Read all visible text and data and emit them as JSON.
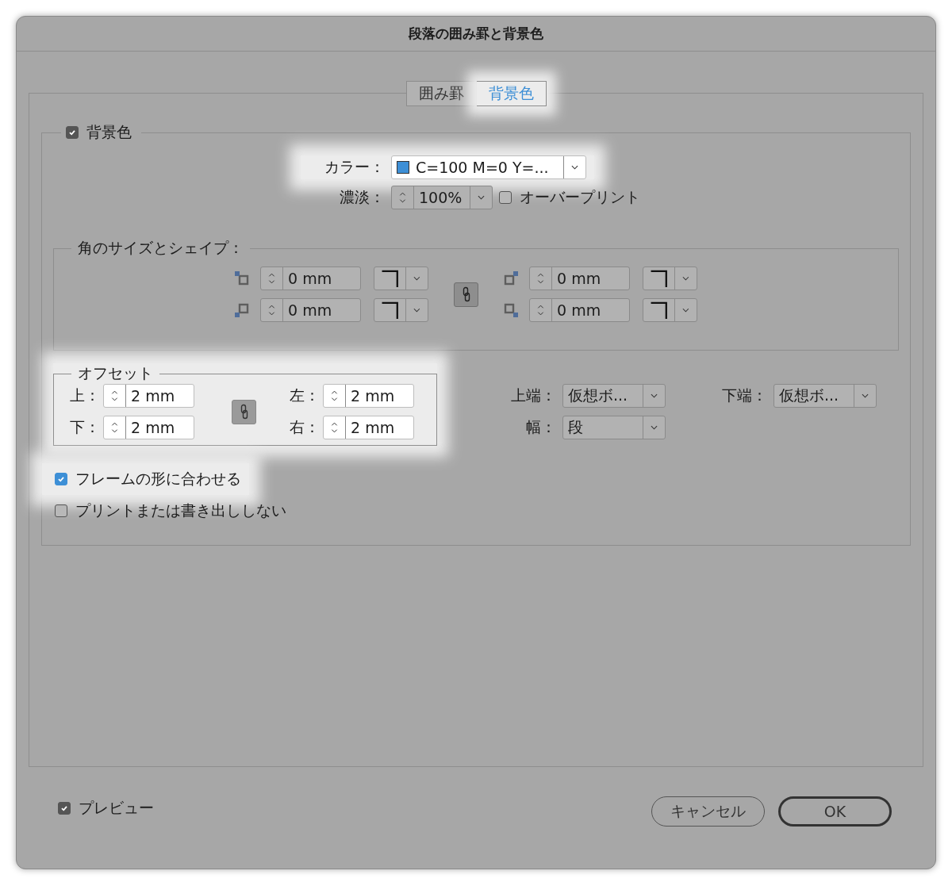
{
  "window": {
    "title": "段落の囲み罫と背景色"
  },
  "tabs": [
    {
      "label": "囲み罫",
      "selected": false,
      "highlighted": false
    },
    {
      "label": "背景色",
      "selected": true,
      "highlighted": true
    }
  ],
  "background": {
    "label": "背景色",
    "checked": true,
    "color": {
      "label": "カラー：",
      "value": "C=100 M=0 Y=...",
      "color": "#3d8fd6",
      "highlighted": true
    },
    "tint": {
      "label": "濃淡：",
      "value": "100%"
    },
    "overprint": {
      "label": "オーバープリント",
      "checked": false
    }
  },
  "corners": {
    "title": "角のサイズとシェイプ：",
    "items": [
      {
        "kind": "top-left",
        "value": "0 mm"
      },
      {
        "kind": "top-right",
        "value": "0 mm"
      },
      {
        "kind": "bottom-left",
        "value": "0 mm"
      },
      {
        "kind": "bottom-right",
        "value": "0 mm"
      }
    ]
  },
  "offset": {
    "title": "オフセット",
    "highlighted": true,
    "fields": [
      {
        "label": "上：",
        "value": "2 mm"
      },
      {
        "label": "下：",
        "value": "2 mm"
      },
      {
        "label": "左：",
        "value": "2 mm"
      },
      {
        "label": "右：",
        "value": "2 mm"
      }
    ]
  },
  "extent": [
    {
      "label": "上端：",
      "value": "仮想ボ..."
    },
    {
      "label": "下端：",
      "value": "仮想ボ..."
    },
    {
      "label": "幅：",
      "value": "段"
    }
  ],
  "options": [
    {
      "label": "フレームの形に合わせる",
      "checked": true,
      "highlighted": true
    },
    {
      "label": "プリントまたは書き出ししない",
      "checked": false,
      "highlighted": false
    }
  ],
  "preview": {
    "label": "プレビュー",
    "checked": true
  },
  "buttons": [
    {
      "label": "キャンセル",
      "kind": "secondary"
    },
    {
      "label": "OK",
      "kind": "default"
    }
  ]
}
